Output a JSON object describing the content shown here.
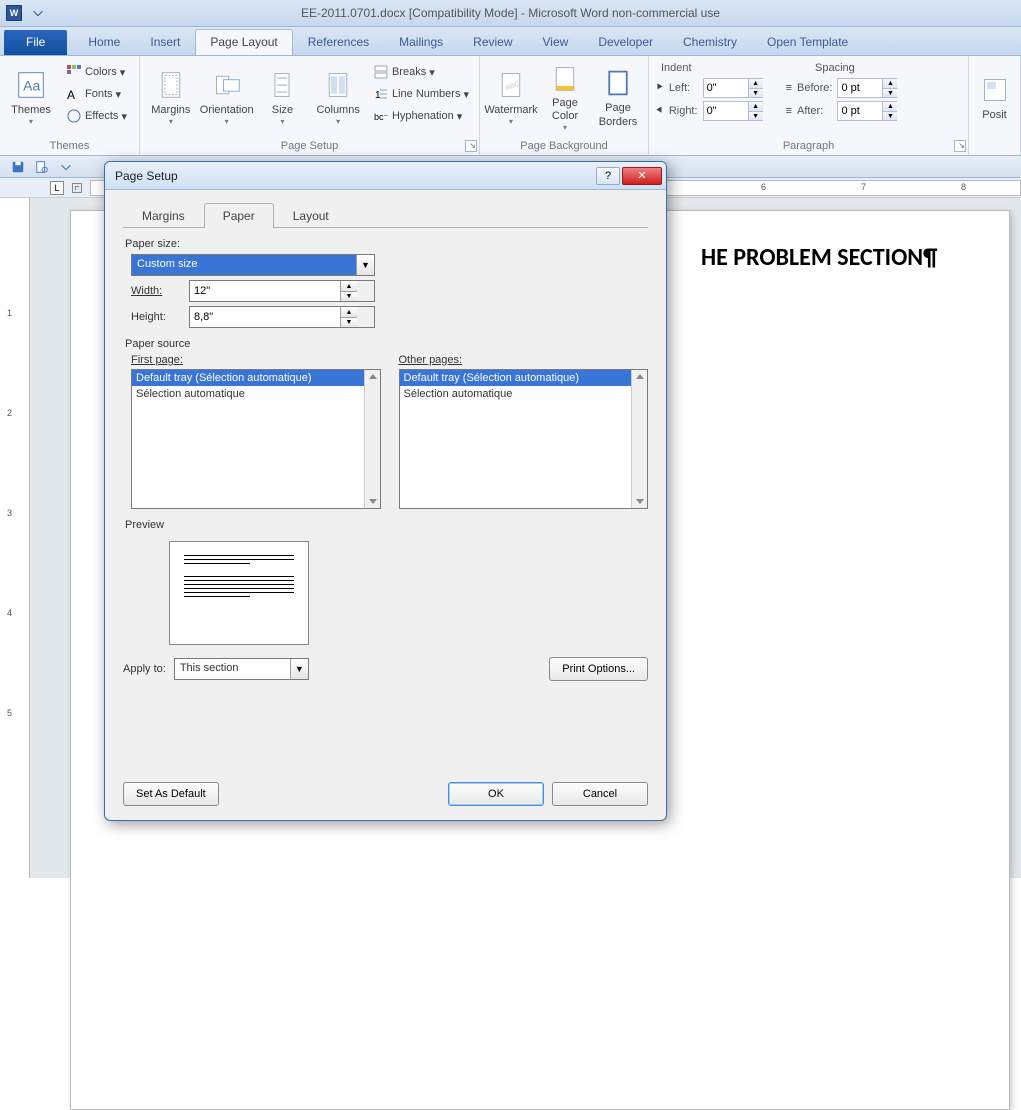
{
  "titlebar": {
    "word_icon_letter": "W",
    "title": "EE-2011.0701.docx [Compatibility Mode] - Microsoft Word non-commercial use"
  },
  "ribbon_tabs": {
    "file": "File",
    "items": [
      "Home",
      "Insert",
      "Page Layout",
      "References",
      "Mailings",
      "Review",
      "View",
      "Developer",
      "Chemistry",
      "Open Template"
    ],
    "active_index": 2
  },
  "ribbon": {
    "themes": {
      "label": "Themes",
      "main": "Themes",
      "colors": "Colors",
      "fonts": "Fonts",
      "effects": "Effects"
    },
    "page_setup": {
      "label": "Page Setup",
      "margins": "Margins",
      "orientation": "Orientation",
      "size": "Size",
      "columns": "Columns",
      "breaks": "Breaks",
      "line_numbers": "Line Numbers",
      "hyphenation": "Hyphenation"
    },
    "page_background": {
      "label": "Page Background",
      "watermark": "Watermark",
      "page_color": "Page Color",
      "page_borders": "Page Borders"
    },
    "indent": {
      "section": "Indent",
      "left_label": "Left:",
      "right_label": "Right:",
      "left_value": "0\"",
      "right_value": "0\""
    },
    "spacing": {
      "section": "Spacing",
      "before_label": "Before:",
      "after_label": "After:",
      "before_value": "0 pt",
      "after_value": "0 pt"
    },
    "paragraph_label": "Paragraph",
    "arrange": {
      "position": "Posit"
    }
  },
  "ruler": {
    "numbers": [
      "6",
      "7",
      "8"
    ],
    "vertical": [
      "1",
      "2",
      "3",
      "4",
      "5"
    ]
  },
  "document": {
    "heading": "HE PROBLEM SECTION¶"
  },
  "dialog": {
    "title": "Page Setup",
    "tabs": [
      "Margins",
      "Paper",
      "Layout"
    ],
    "active_tab": 1,
    "paper_size_label": "Paper size:",
    "paper_size_value": "Custom size",
    "width_label": "Width:",
    "width_value": "12\"",
    "height_label": "Height:",
    "height_value": "8,8\"",
    "paper_source_label": "Paper source",
    "first_page_label": "First page:",
    "other_pages_label": "Other pages:",
    "tray_options": [
      "Default tray (Sélection automatique)",
      "Sélection automatique"
    ],
    "preview_label": "Preview",
    "apply_to_label": "Apply to:",
    "apply_to_value": "This section",
    "print_options": "Print Options...",
    "set_default": "Set As Default",
    "ok": "OK",
    "cancel": "Cancel"
  }
}
